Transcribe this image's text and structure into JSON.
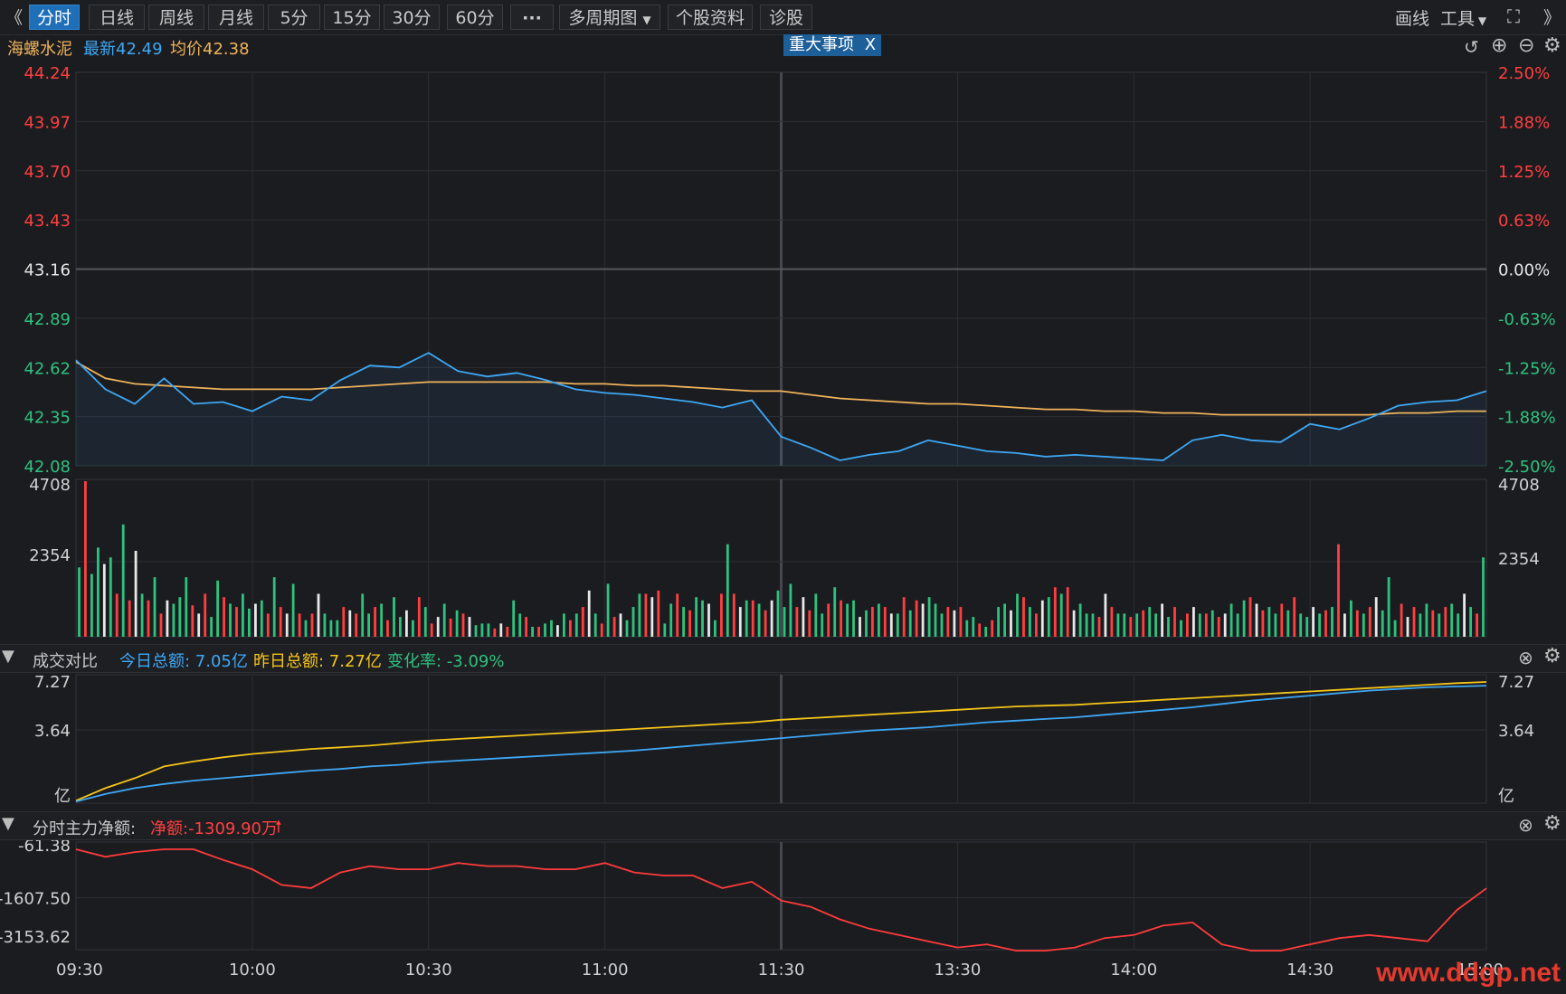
{
  "toolbar": {
    "collapse_left": "《",
    "tabs": [
      "分时",
      "日线",
      "周线",
      "月线",
      "5分",
      "15分",
      "30分",
      "60分",
      "···",
      "多周期图",
      "个股资料",
      "诊股"
    ],
    "draw_label": "画线",
    "tools_label": "工具",
    "expand_right": "》"
  },
  "info": {
    "stock_name": "海螺水泥",
    "latest_label": "最新42.49",
    "avg_label": "均价42.38",
    "event_button": "重大事项",
    "event_close": "X"
  },
  "colors": {
    "price_line": "#3ea8f5",
    "avg_line": "#f0b35a",
    "up": "#ff3f3f",
    "down": "#2ec27e",
    "today_line": "#3ea8f5",
    "yesterday_line": "#f5c518",
    "net_line": "#ff3b3b"
  },
  "panel2": {
    "title": "成交对比",
    "today_total": "今日总额: 7.05亿",
    "yesterday_total": "昨日总额: 7.27亿",
    "change_rate": "变化率: -3.09%"
  },
  "panel3": {
    "title": "分时主力净额:",
    "net_amount": "净额:-1309.90万"
  },
  "watermark": "www.ddgp.net",
  "chart_data": [
    {
      "type": "line",
      "name": "price",
      "x": [
        "09:30",
        "09:35",
        "09:40",
        "09:45",
        "09:50",
        "09:55",
        "10:00",
        "10:05",
        "10:10",
        "10:15",
        "10:20",
        "10:25",
        "10:30",
        "10:35",
        "10:40",
        "10:45",
        "10:50",
        "10:55",
        "11:00",
        "11:05",
        "11:10",
        "11:15",
        "11:20",
        "11:25",
        "11:30",
        "13:05",
        "13:10",
        "13:15",
        "13:20",
        "13:25",
        "13:30",
        "13:35",
        "13:40",
        "13:45",
        "13:50",
        "13:55",
        "14:00",
        "14:05",
        "14:10",
        "14:15",
        "14:20",
        "14:25",
        "14:30",
        "14:35",
        "14:40",
        "14:45",
        "14:50",
        "14:55",
        "15:00"
      ],
      "series": [
        {
          "name": "最新",
          "values": [
            42.66,
            42.5,
            42.42,
            42.56,
            42.42,
            42.43,
            42.38,
            42.46,
            42.44,
            42.55,
            42.63,
            42.62,
            42.7,
            42.6,
            42.57,
            42.59,
            42.55,
            42.5,
            42.48,
            42.47,
            42.45,
            42.43,
            42.4,
            42.44,
            42.24,
            42.18,
            42.11,
            42.14,
            42.16,
            42.22,
            42.19,
            42.16,
            42.15,
            42.13,
            42.14,
            42.13,
            42.12,
            42.11,
            42.22,
            42.25,
            42.22,
            42.21,
            42.31,
            42.28,
            42.34,
            42.41,
            42.43,
            42.44,
            42.49
          ]
        },
        {
          "name": "均价",
          "values": [
            42.65,
            42.56,
            42.53,
            42.52,
            42.51,
            42.5,
            42.5,
            42.5,
            42.5,
            42.51,
            42.52,
            42.53,
            42.54,
            42.54,
            42.54,
            42.54,
            42.54,
            42.53,
            42.53,
            42.52,
            42.52,
            42.51,
            42.5,
            42.49,
            42.49,
            42.47,
            42.45,
            42.44,
            42.43,
            42.42,
            42.42,
            42.41,
            42.4,
            42.39,
            42.39,
            42.38,
            42.38,
            42.37,
            42.37,
            42.36,
            42.36,
            42.36,
            42.36,
            42.36,
            42.36,
            42.37,
            42.37,
            42.38,
            42.38
          ]
        }
      ],
      "ylim": [
        42.08,
        44.24
      ],
      "y_ticks": [
        "44.24",
        "43.97",
        "43.70",
        "43.43",
        "43.16",
        "42.89",
        "42.62",
        "42.35",
        "42.08"
      ],
      "y_ticks_right": [
        "2.50%",
        "1.88%",
        "1.25%",
        "0.63%",
        "0.00%",
        "-0.63%",
        "-1.25%",
        "-1.88%",
        "-2.50%"
      ],
      "prev_close": 43.16,
      "grid": true
    },
    {
      "type": "bar",
      "name": "volume",
      "ylim": [
        0,
        4708
      ],
      "y_ticks": [
        "4708",
        "2354"
      ],
      "values": [
        2100,
        4708,
        1900,
        2700,
        2200,
        2400,
        1300,
        3400,
        1100,
        2600,
        1300,
        1100,
        1800,
        700,
        1100,
        1000,
        1200,
        1800,
        950,
        700,
        1300,
        600,
        1700,
        1200,
        1000,
        900,
        1300,
        850,
        1000,
        1100,
        700,
        1800,
        900,
        700,
        1600,
        700,
        500,
        700,
        1300,
        700,
        500,
        500,
        900,
        800,
        700,
        1300,
        700,
        900,
        1000,
        500,
        1200,
        600,
        800,
        500,
        1200,
        900,
        400,
        600,
        1000,
        550,
        800,
        700,
        600,
        350,
        400,
        400,
        250,
        400,
        300,
        1100,
        700,
        600,
        300,
        300,
        400,
        500,
        350,
        700,
        500,
        700,
        900,
        1400,
        700,
        400,
        1600,
        600,
        700,
        500,
        900,
        1300,
        1300,
        1200,
        1400,
        400,
        1000,
        1300,
        900,
        800,
        1200,
        1100,
        1000,
        500,
        1300,
        2800,
        1300,
        900,
        1100,
        1100,
        1000,
        800,
        1100,
        1400,
        900,
        1600,
        900,
        1200,
        800,
        1300,
        700,
        1000,
        1500,
        1100,
        1000,
        1100,
        600,
        800,
        900,
        1000,
        900,
        700,
        700,
        1200,
        800,
        1100,
        1000,
        1200,
        1000,
        700,
        900,
        800,
        900,
        500,
        600,
        400,
        300,
        500,
        900,
        1000,
        800,
        1300,
        1200,
        900,
        700,
        1100,
        1200,
        1500,
        1300,
        1500,
        800,
        1000,
        700,
        700,
        600,
        1300,
        900,
        700,
        700,
        600,
        700,
        800,
        900,
        700,
        1000,
        600,
        900,
        500,
        700,
        900,
        700,
        700,
        800,
        600,
        700,
        1000,
        700,
        1100,
        1200,
        1000,
        800,
        900,
        700,
        1000,
        800,
        1200,
        700,
        600,
        900,
        700,
        800,
        900,
        2800,
        700,
        1100,
        800,
        700,
        900,
        1200,
        800,
        1800,
        500,
        1000,
        600,
        900,
        700,
        1000,
        800,
        700,
        900,
        1000,
        700,
        1300,
        900,
        700,
        2400
      ],
      "up_pattern": "mixed"
    },
    {
      "type": "line",
      "name": "turnover_compare",
      "series": [
        {
          "name": "今日",
          "values": [
            0.1,
            0.55,
            0.9,
            1.15,
            1.35,
            1.5,
            1.65,
            1.8,
            1.95,
            2.05,
            2.2,
            2.3,
            2.45,
            2.55,
            2.65,
            2.75,
            2.85,
            2.95,
            3.05,
            3.15,
            3.3,
            3.45,
            3.6,
            3.75,
            3.9,
            4.05,
            4.2,
            4.35,
            4.45,
            4.55,
            4.7,
            4.85,
            4.95,
            5.05,
            5.15,
            5.3,
            5.45,
            5.6,
            5.75,
            5.95,
            6.15,
            6.3,
            6.45,
            6.6,
            6.75,
            6.85,
            6.95,
            7.0,
            7.05
          ]
        },
        {
          "name": "昨日",
          "values": [
            0.15,
            0.9,
            1.5,
            2.2,
            2.5,
            2.75,
            2.95,
            3.1,
            3.25,
            3.35,
            3.45,
            3.6,
            3.75,
            3.85,
            3.95,
            4.05,
            4.15,
            4.25,
            4.35,
            4.45,
            4.55,
            4.65,
            4.75,
            4.85,
            5.0,
            5.1,
            5.2,
            5.3,
            5.4,
            5.5,
            5.6,
            5.7,
            5.8,
            5.85,
            5.9,
            6.0,
            6.1,
            6.2,
            6.3,
            6.4,
            6.5,
            6.6,
            6.7,
            6.8,
            6.9,
            7.0,
            7.1,
            7.2,
            7.27
          ]
        }
      ],
      "ylim": [
        0,
        7.27
      ],
      "y_ticks": [
        "7.27",
        "3.64",
        "亿"
      ]
    },
    {
      "type": "line",
      "name": "main_net",
      "values": [
        -61.38,
        -300,
        -150,
        -61.38,
        -61.38,
        -400,
        -700,
        -1200,
        -1300,
        -800,
        -600,
        -700,
        -700,
        -500,
        -600,
        -600,
        -700,
        -700,
        -500,
        -800,
        -900,
        -900,
        -1300,
        -1100,
        -1700,
        -1900,
        -2300,
        -2600,
        -2800,
        -3000,
        -3200,
        -3100,
        -3300,
        -3300,
        -3200,
        -2900,
        -2800,
        -2500,
        -2400,
        -3100,
        -3300,
        -3300,
        -3100,
        -2900,
        -2800,
        -2900,
        -3000,
        -2000,
        -1309.9
      ],
      "ylim": [
        -3153.62,
        -61.38
      ],
      "y_ticks": [
        "-61.38",
        "-1607.50",
        "-3153.62"
      ]
    }
  ],
  "x_axis": [
    "09:30",
    "10:00",
    "10:30",
    "11:00",
    "11:30",
    "13:30",
    "14:00",
    "14:30",
    "15:00"
  ]
}
